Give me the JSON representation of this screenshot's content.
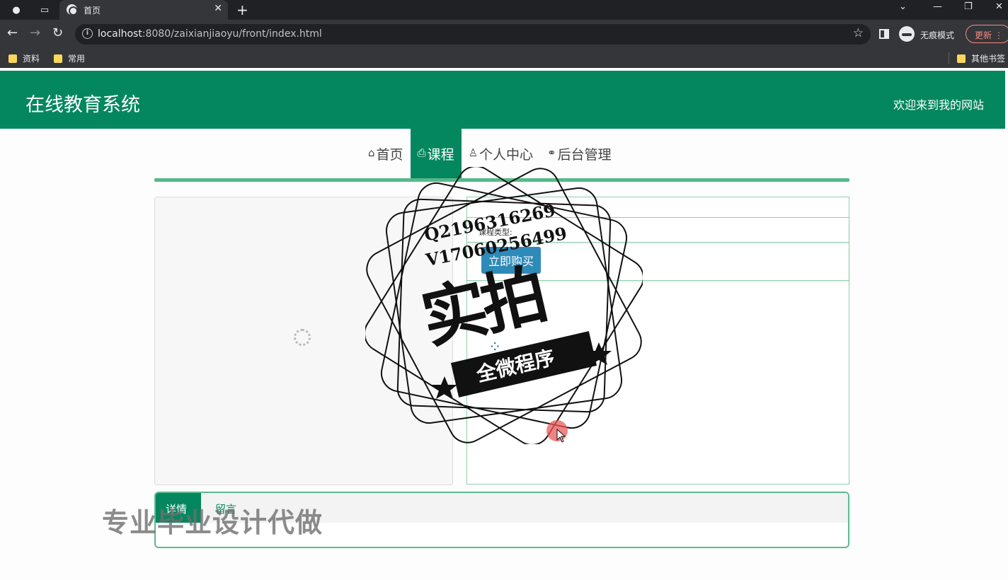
{
  "browser": {
    "tab_title": "首页",
    "url_host": "localhost",
    "url_rest": ":8080/zaixianjiaoyu/front/index.html",
    "incognito_label": "无痕模式",
    "update_label": "更新",
    "bookmarks": [
      "资料",
      "常用"
    ],
    "other_bookmarks": "其他书签"
  },
  "site": {
    "title": "在线教育系统",
    "welcome": "欢迎来到我的网站"
  },
  "nav": {
    "items": [
      {
        "label": "首页",
        "icon": "home-icon"
      },
      {
        "label": "课程",
        "icon": "print-icon"
      },
      {
        "label": "个人中心",
        "icon": "user-icon"
      },
      {
        "label": "后台管理",
        "icon": "link-icon"
      }
    ],
    "active": "课程"
  },
  "course": {
    "type_label": "课程类型:",
    "buy_button": "立即购买"
  },
  "tabs": {
    "detail": "详情",
    "comment": "留言"
  },
  "watermark": {
    "qq": "Q2196316269",
    "vx": "V17060256499",
    "big": "实拍",
    "banner": "全微程序",
    "bottom": "专业毕业设计代做"
  },
  "colors": {
    "brand": "#04875e",
    "button": "#2e8ab8",
    "border": "#8fcfb0"
  }
}
